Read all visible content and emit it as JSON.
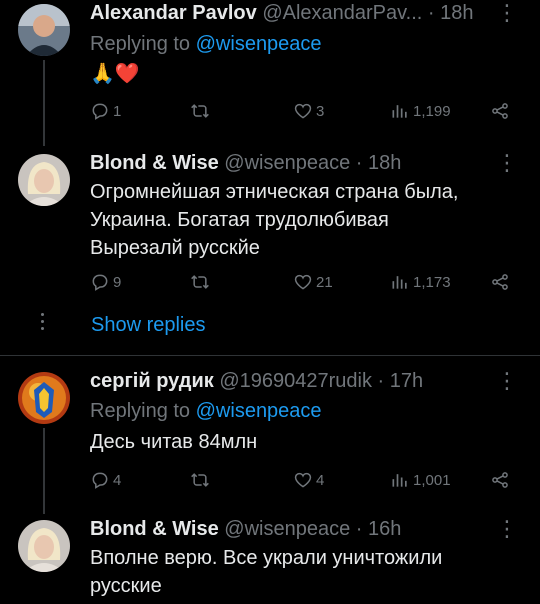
{
  "tweets": [
    {
      "name": "Alexandar Pavlov",
      "handle": "@AlexandarPav...",
      "time": "· 18h",
      "replying_label": "Replying to",
      "replying_to": "@wisenpeace",
      "text": "🙏❤️",
      "actions": {
        "replies": "1",
        "retweets": "",
        "likes": "3",
        "views": "1,199"
      }
    },
    {
      "name": "Blond & Wise",
      "handle": "@wisenpeace",
      "time": "· 18h",
      "text_lines": [
        "Огромнейшая этническая страна была,",
        "Украина. Богатая трудолюбивая",
        "Вырезалй русскйе"
      ],
      "actions": {
        "replies": "9",
        "retweets": "",
        "likes": "21",
        "views": "1,173"
      }
    },
    {
      "name": "сергій рудик",
      "handle": "@19690427rudik",
      "time": "· 17h",
      "replying_label": "Replying to",
      "replying_to": "@wisenpeace",
      "text": "Десь читав 84млн",
      "actions": {
        "replies": "4",
        "retweets": "",
        "likes": "4",
        "views": "1,001"
      }
    },
    {
      "name": "Blond & Wise",
      "handle": "@wisenpeace",
      "time": "· 16h",
      "text_lines": [
        "Вполне верю. Все украли уничтожили",
        "русские"
      ]
    }
  ],
  "show_replies": "Show replies",
  "icons": [
    "reply-icon",
    "retweet-icon",
    "like-icon",
    "views-icon",
    "share-icon",
    "more-icon"
  ],
  "colors": {
    "background": "#000000",
    "text": "#e7e9ea",
    "muted": "#71767b",
    "link": "#1d9bf0"
  }
}
